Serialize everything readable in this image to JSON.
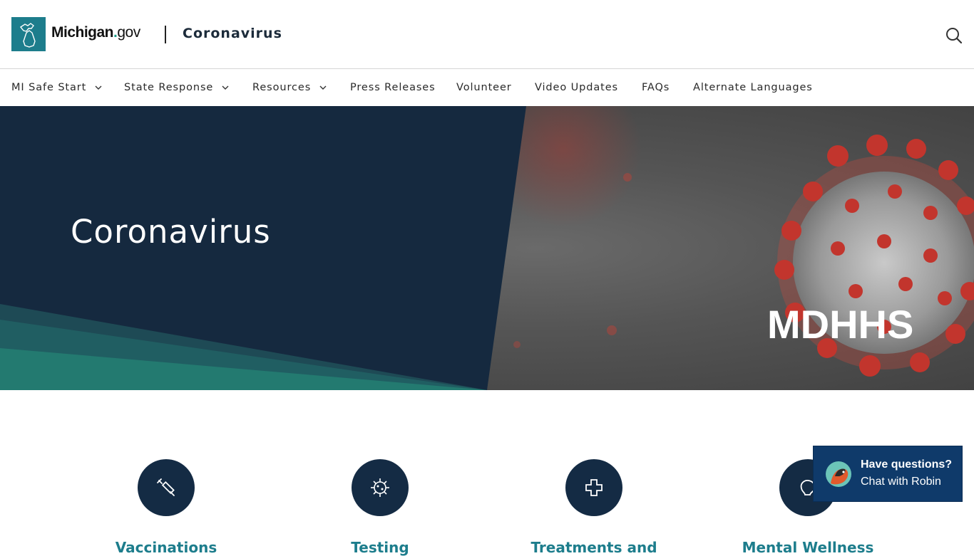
{
  "header": {
    "brand_main": "Michigan",
    "brand_dot": ".",
    "brand_suffix": "gov",
    "site_title": "Coronavirus",
    "search_icon": "search-icon"
  },
  "nav": {
    "items": [
      {
        "label": "MI Safe Start",
        "has_dropdown": true
      },
      {
        "label": "State Response",
        "has_dropdown": true
      },
      {
        "label": "Resources",
        "has_dropdown": true
      },
      {
        "label": "Press Releases",
        "has_dropdown": false
      },
      {
        "label": "Volunteer",
        "has_dropdown": false
      },
      {
        "label": "Video Updates",
        "has_dropdown": false
      },
      {
        "label": "FAQs",
        "has_dropdown": false
      },
      {
        "label": "Alternate Languages",
        "has_dropdown": false
      }
    ]
  },
  "hero": {
    "title": "Coronavirus",
    "logo_text": "MDHHS"
  },
  "cards": [
    {
      "label": "Vaccinations",
      "icon": "syringe-icon"
    },
    {
      "label": "Testing",
      "icon": "virus-icon"
    },
    {
      "label": "Treatments and",
      "icon": "medical-cross-icon"
    },
    {
      "label": "Mental Wellness",
      "icon": "brain-icon"
    }
  ],
  "chat": {
    "question": "Have questions?",
    "cta": "Chat with Robin",
    "avatar_icon": "robin-bird-icon"
  },
  "colors": {
    "navy": "#142b44",
    "teal": "#1d7d8c",
    "chat_bg": "#0f3a6a"
  }
}
